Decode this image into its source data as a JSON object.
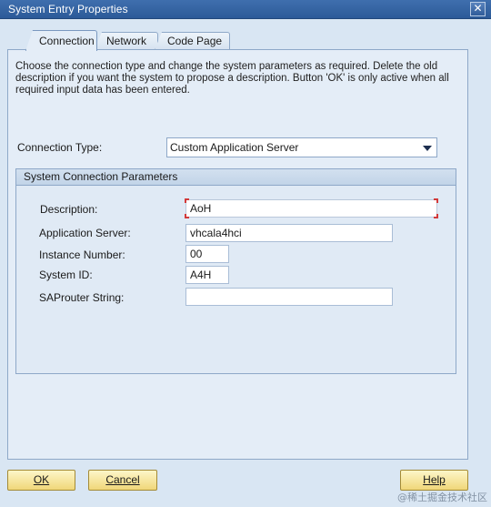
{
  "window": {
    "title": "System Entry Properties",
    "close_glyph": "✕"
  },
  "tabs": [
    {
      "label": "Connection",
      "active": true
    },
    {
      "label": "Network",
      "active": false
    },
    {
      "label": "Code Page",
      "active": false
    }
  ],
  "instructions": "Choose the connection type and change the system parameters as required. Delete the old description if you want the system to propose a description. Button 'OK' is only active when all required input data has been entered.",
  "connection_type": {
    "label": "Connection Type:",
    "value": "Custom Application Server"
  },
  "group": {
    "title": "System Connection Parameters",
    "fields": {
      "description": {
        "label": "Description:",
        "value": "AoH"
      },
      "application_server": {
        "label": "Application Server:",
        "value": "vhcala4hci"
      },
      "instance_number": {
        "label": "Instance Number:",
        "value": "00"
      },
      "system_id": {
        "label": "System ID:",
        "value": "A4H"
      },
      "saprouter": {
        "label": "SAProuter String:",
        "value": ""
      }
    }
  },
  "buttons": {
    "ok": "OK",
    "cancel": "Cancel",
    "help": "Help"
  },
  "watermark": "@稀土掘金技术社区",
  "colors": {
    "titlebar": "#2c5a98",
    "background": "#d9e6f3",
    "button": "#f0d779",
    "focus_corner": "#d23a3a"
  }
}
